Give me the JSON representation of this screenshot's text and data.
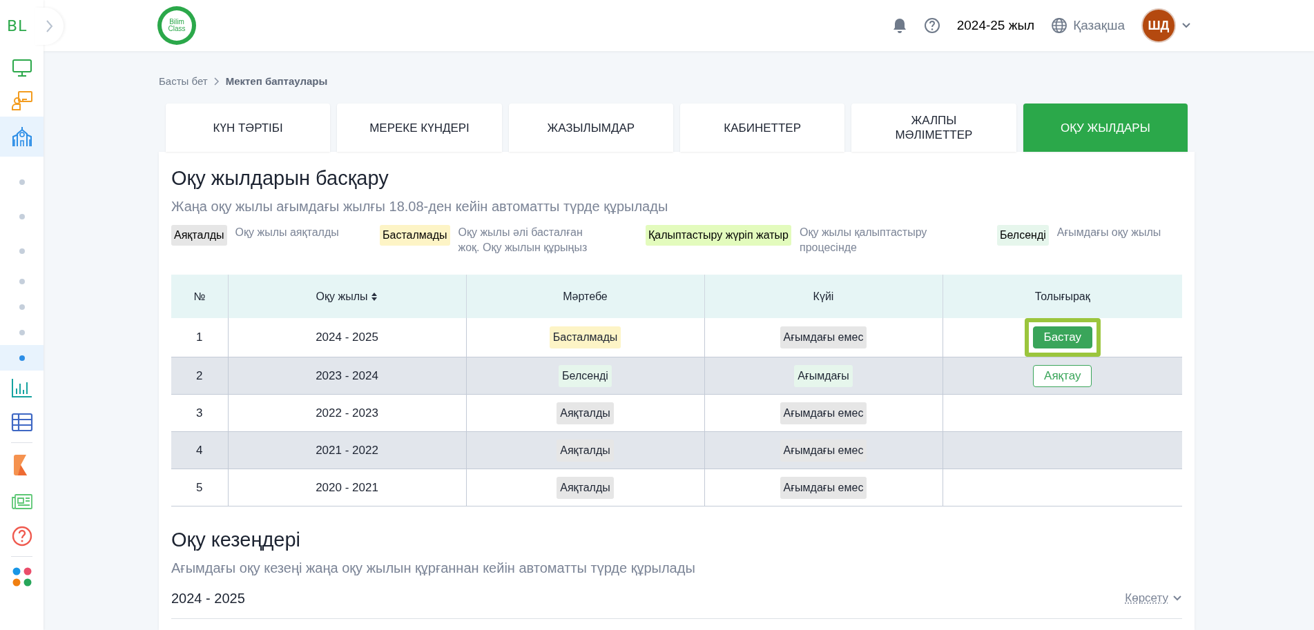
{
  "sidebar": {
    "logo": "BL",
    "sections": [
      [
        {
          "kind": "monitor",
          "selected": false
        },
        {
          "kind": "teacher",
          "selected": false
        },
        {
          "kind": "school",
          "selected": true
        },
        {
          "kind": "dot",
          "selected": false
        },
        {
          "kind": "dot",
          "selected": false
        },
        {
          "kind": "dot",
          "selected": false
        },
        {
          "kind": "dot",
          "selected": false
        },
        {
          "kind": "dot",
          "selected": false
        },
        {
          "kind": "dot",
          "selected": false
        },
        {
          "kind": "dot",
          "selected": true
        },
        {
          "kind": "chart",
          "selected": false
        },
        {
          "kind": "table",
          "selected": false
        }
      ],
      [
        {
          "kind": "k",
          "selected": false
        },
        {
          "kind": "news",
          "selected": false
        },
        {
          "kind": "help",
          "selected": false
        }
      ],
      [
        {
          "kind": "apps",
          "selected": false
        }
      ]
    ]
  },
  "header": {
    "logo": "Bilim Class",
    "year": "2024-25 жыл",
    "language": "Қазақша",
    "avatar": "ШД"
  },
  "breadcrumb": [
    "Басты бет",
    "Мектеп баптаулары"
  ],
  "tabs": [
    {
      "label": "КҮН ТӘРТІБІ",
      "selected": false
    },
    {
      "label": "МЕРЕКЕ КҮНДЕРІ",
      "selected": false
    },
    {
      "label": "ЖАЗЫЛЫМДАР",
      "selected": false
    },
    {
      "label": "КАБИНЕТТЕР",
      "selected": false
    },
    {
      "label": "ЖАЛПЫ МӘЛІМЕТТЕР",
      "selected": false
    },
    {
      "label": "ОҚУ ЖЫЛДАРЫ",
      "selected": true
    }
  ],
  "years_section": {
    "title": "Оқу жылдарын басқару",
    "subtitle": "Жаңа оқу жылы ағымдағы жылғы 18.08-ден кейін автоматты түрде құрылады",
    "legend": [
      {
        "badge": "Аяқталды",
        "color": "#e6e6e6",
        "text": "Оқу жылы аяқталды"
      },
      {
        "badge": "Басталмады",
        "color": "#fdf4c6",
        "text": "Оқу жылы әлі басталған жоқ. Оқу жылын құрыңыз"
      },
      {
        "badge": "Қалыптастыру жүріп жатыр",
        "color": "#e3fbbd",
        "text": "Оқу жылы қалыптастыру процесінде"
      },
      {
        "badge": "Белсенді",
        "color": "#e6f6ec",
        "text": "Ағымдағы оқу жылы"
      }
    ],
    "table": {
      "columns": [
        "№",
        "Оқу жылы",
        "Мәртебе",
        "Күйі",
        "Толығырақ"
      ],
      "rows": [
        {
          "number": "1",
          "year": "2024 - 2025",
          "status": "Басталмады",
          "color": "#fdf4c6",
          "state": "Ағымдағы емес",
          "current": false,
          "action": {
            "label": "Бастау",
            "kind": "start",
            "highlighted": true
          }
        },
        {
          "number": "2",
          "year": "2023 - 2024",
          "status": "Белсенді",
          "color": "#e6f6ec",
          "state": "Ағымдағы",
          "current": true,
          "action": {
            "label": "Аяқтау",
            "kind": "finish",
            "highlighted": false
          }
        },
        {
          "number": "3",
          "year": "2022 - 2023",
          "status": "Аяқталды",
          "color": "#e6e6e6",
          "state": "Ағымдағы емес",
          "current": false
        },
        {
          "number": "4",
          "year": "2021 - 2022",
          "status": "Аяқталды",
          "color": "#e6e6e6",
          "state": "Ағымдағы емес",
          "current": false
        },
        {
          "number": "5",
          "year": "2020 - 2021",
          "status": "Аяқталды",
          "color": "#e6e6e6",
          "state": "Ағымдағы емес",
          "current": false
        }
      ]
    }
  },
  "periods_section": {
    "title": "Оқу кезеңдері",
    "subtitle": "Ағымдағы оқу кезеңі жаңа оқу жылын құрғаннан кейін автоматты түрде құрылады",
    "year": "2024 - 2025",
    "toggle": "Көрсету",
    "expanded": false
  }
}
